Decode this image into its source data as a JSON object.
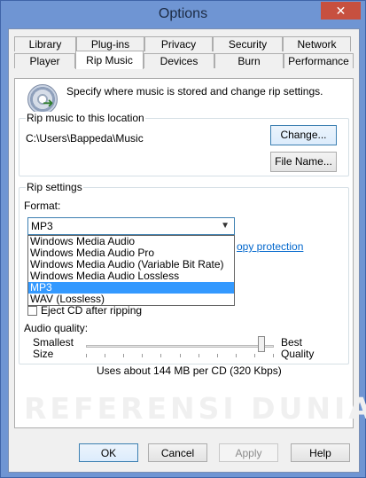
{
  "window": {
    "title": "Options",
    "close_glyph": "✕"
  },
  "tabs": {
    "row1": [
      "Library",
      "Plug-ins",
      "Privacy",
      "Security",
      "Network"
    ],
    "row2": [
      "Player",
      "Rip Music",
      "Devices",
      "Burn",
      "Performance"
    ],
    "active": "Rip Music"
  },
  "rip_music": {
    "description": "Specify where music is stored and change rip settings.",
    "location_group": "Rip music to this location",
    "path": "C:\\Users\\Bappeda\\Music",
    "change_button": "Change...",
    "file_name_button": "File Name...",
    "settings_group": "Rip settings",
    "format_label": "Format:",
    "format_selected": "MP3",
    "format_options": [
      "Windows Media Audio",
      "Windows Media Audio Pro",
      "Windows Media Audio (Variable Bit Rate)",
      "Windows Media Audio Lossless",
      "MP3",
      "WAV (Lossless)"
    ],
    "highlighted_option": "MP3",
    "copy_protection_link": "opy protection",
    "eject_label": "Eject CD after ripping",
    "eject_checked": false,
    "audio_quality_label": "Audio quality:",
    "slider_min": "Smallest Size",
    "slider_max": "Best Quality",
    "quality_level": 0.95,
    "usage_text": "Uses about 144 MB per CD (320 Kbps)",
    "watermark": "REFERENSI DUNIA"
  },
  "footer": {
    "ok": "OK",
    "cancel": "Cancel",
    "apply": "Apply",
    "help": "Help"
  },
  "colors": {
    "title_bar": "#6f95d3",
    "close_button": "#c7503f",
    "selection": "#3399ff",
    "link": "#0066cc"
  }
}
